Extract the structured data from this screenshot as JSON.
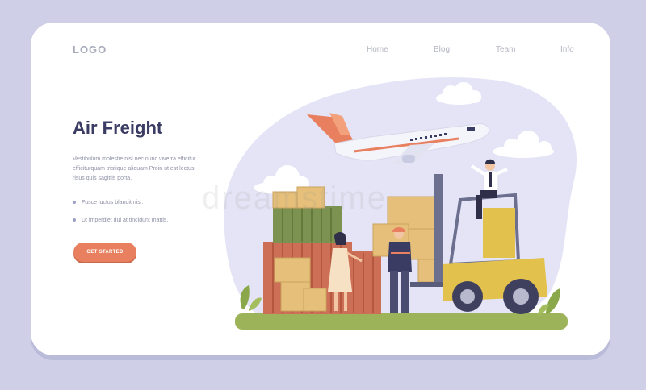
{
  "header": {
    "logo": "LOGO",
    "nav": [
      "Home",
      "Blog",
      "Team",
      "Info"
    ]
  },
  "hero": {
    "title": "Air Freight",
    "description": "Vestibulum molestie nisl nec nunc viverra efficitur. efficiturquam tristique aliquam Proin ut est lectus. risus quis sagittis porta.",
    "bullets": [
      "Fusce luctus blandit nisi.",
      "Ut imperdiet dui at tincidunt mattis."
    ],
    "cta": "GET STARTED"
  },
  "watermark": "dreamstime",
  "colors": {
    "background": "#cfd0e8",
    "accent": "#e8805f",
    "title": "#3b3c63",
    "blob": "#e4e4f6"
  }
}
